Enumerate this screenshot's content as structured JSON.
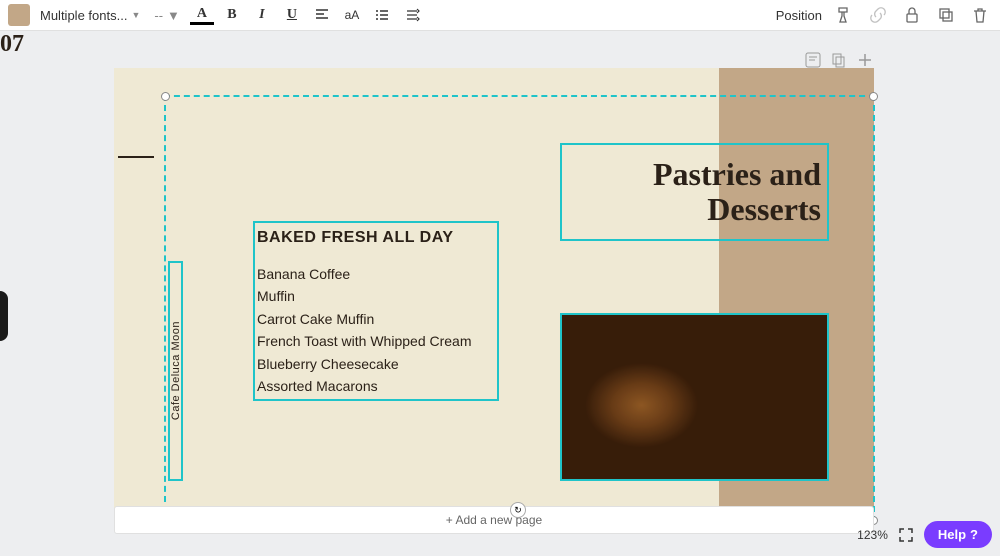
{
  "toolbar": {
    "font_label": "Multiple fonts...",
    "font_size": "--",
    "text_color_btn": "A",
    "bold": "B",
    "italic": "I",
    "underline": "U",
    "case": "aA",
    "position_label": "Position"
  },
  "page": {
    "number": "07",
    "side_label": "Cafe Deluca Moon",
    "title": "Pastries and Desserts",
    "menu_heading": "BAKED FRESH ALL DAY",
    "menu_items": [
      "Banana Coffee",
      "Muffin",
      "Carrot Cake Muffin",
      "French Toast with Whipped Cream",
      "Blueberry Cheesecake",
      "Assorted Macarons"
    ]
  },
  "footer": {
    "add_page": "+ Add a new page",
    "zoom": "123%",
    "help": "Help",
    "help_q": "?"
  }
}
